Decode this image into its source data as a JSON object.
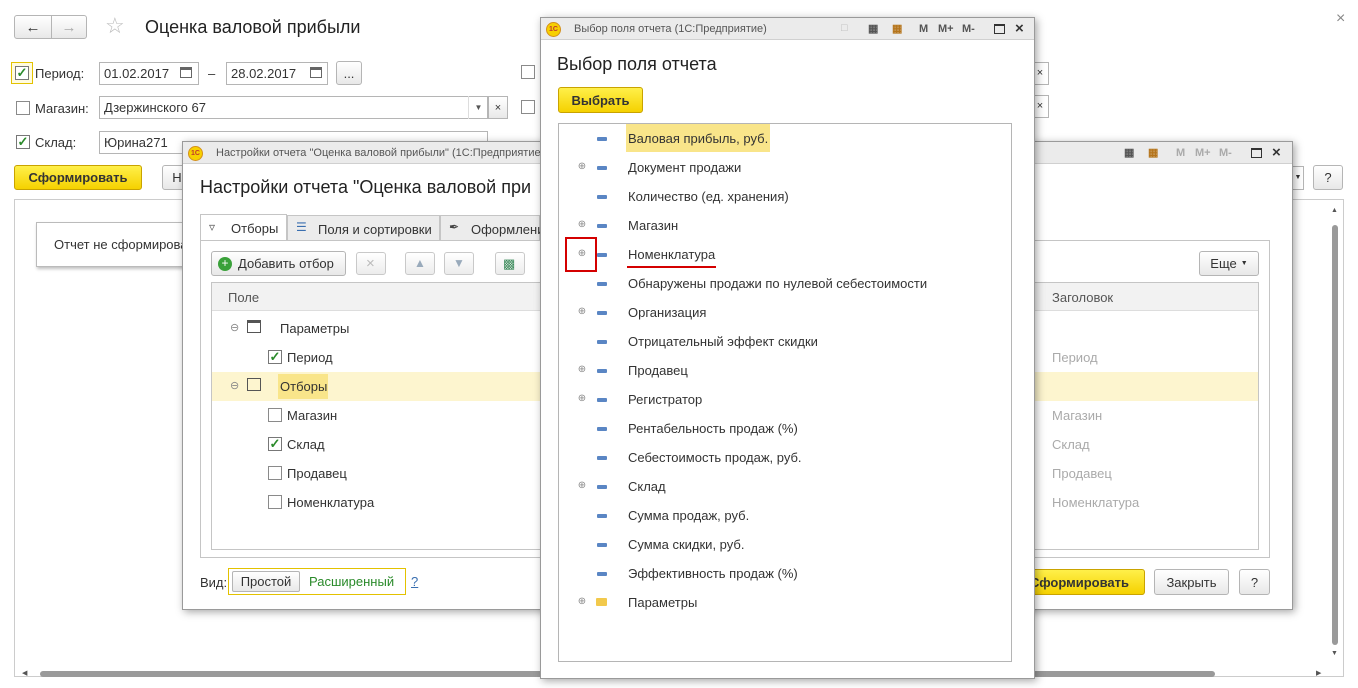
{
  "main": {
    "title": "Оценка валовой прибыли",
    "period_label": "Период:",
    "date_from": "01.02.2017",
    "date_sep": "–",
    "date_to": "28.02.2017",
    "more_label": "...",
    "shop_label": "Магазин:",
    "shop_value": "Дзержинского 67",
    "warehouse_label": "Склад:",
    "warehouse_value": "Юрина271",
    "generate_label": "Сформировать",
    "partial_label": "Н",
    "help_label": "?",
    "report_status": "Отчет не сформирова"
  },
  "settings": {
    "window_title": "Настройки отчета \"Оценка валовой прибыли\"  (1С:Предприятие",
    "heading": "Настройки отчета \"Оценка валовой при",
    "tabs": [
      {
        "label": "Отборы"
      },
      {
        "label": "Поля и сортировки"
      },
      {
        "label": "Оформлени"
      }
    ],
    "add_filter_label": "Добавить отбор",
    "more_label": "Еще",
    "col_field": "Поле",
    "col_header": "Заголовок",
    "group_params": "Параметры",
    "group_filters": "Отборы",
    "rows": [
      {
        "label": "Период",
        "checked": true,
        "header": "Период"
      },
      {
        "label": "Магазин",
        "checked": false,
        "header": "Магазин"
      },
      {
        "label": "Склад",
        "checked": true,
        "header": "Склад"
      },
      {
        "label": "Продавец",
        "checked": false,
        "header": "Продавец"
      },
      {
        "label": "Номенклатура",
        "checked": false,
        "header": "Номенклатура"
      }
    ],
    "view_label": "Вид:",
    "view_simple": "Простой",
    "view_extended": "Расширенный",
    "view_help": "?",
    "generate_label": "Сформировать",
    "close_label": "Закрыть",
    "help_label": "?"
  },
  "chooser": {
    "window_title": "Выбор поля отчета   (1С:Предприятие)",
    "heading": "Выбор поля отчета",
    "select_label": "Выбрать",
    "items": [
      {
        "label": "Валовая прибыль, руб.",
        "expandable": false,
        "selected": true
      },
      {
        "label": "Документ продажи",
        "expandable": true,
        "selected": false
      },
      {
        "label": "Количество (ед. хранения)",
        "expandable": false,
        "selected": false
      },
      {
        "label": "Магазин",
        "expandable": true,
        "selected": false
      },
      {
        "label": "Номенклатура",
        "expandable": true,
        "selected": false
      },
      {
        "label": "Обнаружены продажи по нулевой себестоимости",
        "expandable": false,
        "selected": false
      },
      {
        "label": "Организация",
        "expandable": true,
        "selected": false
      },
      {
        "label": "Отрицательный эффект скидки",
        "expandable": false,
        "selected": false
      },
      {
        "label": "Продавец",
        "expandable": true,
        "selected": false
      },
      {
        "label": "Регистратор",
        "expandable": true,
        "selected": false
      },
      {
        "label": "Рентабельность продаж (%)",
        "expandable": false,
        "selected": false
      },
      {
        "label": "Себестоимость продаж, руб.",
        "expandable": false,
        "selected": false
      },
      {
        "label": "Склад",
        "expandable": true,
        "selected": false
      },
      {
        "label": "Сумма продаж, руб.",
        "expandable": false,
        "selected": false
      },
      {
        "label": "Сумма скидки, руб.",
        "expandable": false,
        "selected": false
      },
      {
        "label": "Эффективность продаж (%)",
        "expandable": false,
        "selected": false
      },
      {
        "label": "Параметры",
        "expandable": true,
        "selected": false,
        "folder": true
      }
    ]
  },
  "colors": {
    "accent_yellow": "#f5d100",
    "highlight_row": "#fdf5cf",
    "annotation_red": "#d40000"
  }
}
